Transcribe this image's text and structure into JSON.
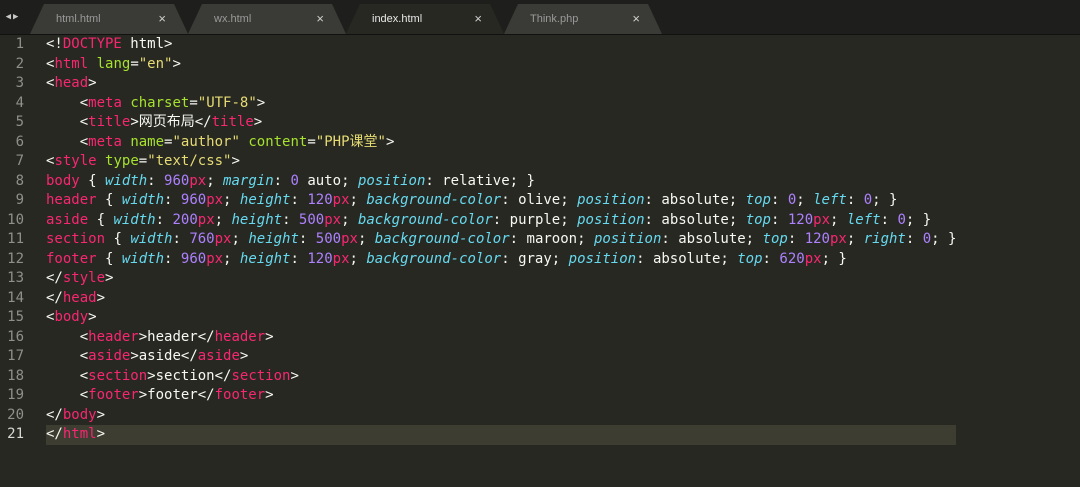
{
  "tabs": [
    {
      "label": "html.html",
      "active": false
    },
    {
      "label": "wx.html",
      "active": false
    },
    {
      "label": "index.html",
      "active": true
    },
    {
      "label": "Think.php",
      "active": false
    }
  ],
  "tab_close_glyph": "×",
  "nav": {
    "back_icon": "◀",
    "forward_icon": "▶"
  },
  "editor": {
    "current_line": 21,
    "line_numbers": [
      "1",
      "2",
      "3",
      "4",
      "5",
      "6",
      "7",
      "8",
      "9",
      "10",
      "11",
      "12",
      "13",
      "14",
      "15",
      "16",
      "17",
      "18",
      "19",
      "20",
      "21"
    ],
    "lines": [
      [
        [
          "p",
          "<!"
        ],
        [
          "tg",
          "DOCTYPE"
        ],
        [
          "p",
          " html>"
        ]
      ],
      [
        [
          "p",
          "<"
        ],
        [
          "tg",
          "html"
        ],
        [
          "p",
          " "
        ],
        [
          "at",
          "lang"
        ],
        [
          "p",
          "="
        ],
        [
          "st",
          "\"en\""
        ],
        [
          "p",
          ">"
        ]
      ],
      [
        [
          "p",
          "<"
        ],
        [
          "tg",
          "head"
        ],
        [
          "p",
          ">"
        ]
      ],
      [
        [
          "p",
          "    <"
        ],
        [
          "tg",
          "meta"
        ],
        [
          "p",
          " "
        ],
        [
          "at",
          "charset"
        ],
        [
          "p",
          "="
        ],
        [
          "st",
          "\"UTF-8\""
        ],
        [
          "p",
          ">"
        ]
      ],
      [
        [
          "p",
          "    <"
        ],
        [
          "tg",
          "title"
        ],
        [
          "p",
          ">网页布局</"
        ],
        [
          "tg",
          "title"
        ],
        [
          "p",
          ">"
        ]
      ],
      [
        [
          "p",
          "    <"
        ],
        [
          "tg",
          "meta"
        ],
        [
          "p",
          " "
        ],
        [
          "at",
          "name"
        ],
        [
          "p",
          "="
        ],
        [
          "st",
          "\"author\""
        ],
        [
          "p",
          " "
        ],
        [
          "at",
          "content"
        ],
        [
          "p",
          "="
        ],
        [
          "st",
          "\"PHP课堂\""
        ],
        [
          "p",
          ">"
        ]
      ],
      [
        [
          "p",
          "<"
        ],
        [
          "tg",
          "style"
        ],
        [
          "p",
          " "
        ],
        [
          "at",
          "type"
        ],
        [
          "p",
          "="
        ],
        [
          "st",
          "\"text/css\""
        ],
        [
          "p",
          ">"
        ]
      ],
      [
        [
          "tg",
          "body"
        ],
        [
          "p",
          " { "
        ],
        [
          "pr",
          "width"
        ],
        [
          "p",
          ": "
        ],
        [
          "nm",
          "960"
        ],
        [
          "un",
          "px"
        ],
        [
          "p",
          "; "
        ],
        [
          "pr",
          "margin"
        ],
        [
          "p",
          ": "
        ],
        [
          "nm",
          "0"
        ],
        [
          "p",
          " auto; "
        ],
        [
          "pr",
          "position"
        ],
        [
          "p",
          ": relative; }"
        ]
      ],
      [
        [
          "tg",
          "header"
        ],
        [
          "p",
          " { "
        ],
        [
          "pr",
          "width"
        ],
        [
          "p",
          ": "
        ],
        [
          "nm",
          "960"
        ],
        [
          "un",
          "px"
        ],
        [
          "p",
          "; "
        ],
        [
          "pr",
          "height"
        ],
        [
          "p",
          ": "
        ],
        [
          "nm",
          "120"
        ],
        [
          "un",
          "px"
        ],
        [
          "p",
          "; "
        ],
        [
          "pr",
          "background-color"
        ],
        [
          "p",
          ": olive; "
        ],
        [
          "pr",
          "position"
        ],
        [
          "p",
          ": absolute; "
        ],
        [
          "pr",
          "top"
        ],
        [
          "p",
          ": "
        ],
        [
          "nm",
          "0"
        ],
        [
          "p",
          "; "
        ],
        [
          "pr",
          "left"
        ],
        [
          "p",
          ": "
        ],
        [
          "nm",
          "0"
        ],
        [
          "p",
          "; }"
        ]
      ],
      [
        [
          "tg",
          "aside"
        ],
        [
          "p",
          " { "
        ],
        [
          "pr",
          "width"
        ],
        [
          "p",
          ": "
        ],
        [
          "nm",
          "200"
        ],
        [
          "un",
          "px"
        ],
        [
          "p",
          "; "
        ],
        [
          "pr",
          "height"
        ],
        [
          "p",
          ": "
        ],
        [
          "nm",
          "500"
        ],
        [
          "un",
          "px"
        ],
        [
          "p",
          "; "
        ],
        [
          "pr",
          "background-color"
        ],
        [
          "p",
          ": purple; "
        ],
        [
          "pr",
          "position"
        ],
        [
          "p",
          ": absolute; "
        ],
        [
          "pr",
          "top"
        ],
        [
          "p",
          ": "
        ],
        [
          "nm",
          "120"
        ],
        [
          "un",
          "px"
        ],
        [
          "p",
          "; "
        ],
        [
          "pr",
          "left"
        ],
        [
          "p",
          ": "
        ],
        [
          "nm",
          "0"
        ],
        [
          "p",
          "; }"
        ]
      ],
      [
        [
          "tg",
          "section"
        ],
        [
          "p",
          " { "
        ],
        [
          "pr",
          "width"
        ],
        [
          "p",
          ": "
        ],
        [
          "nm",
          "760"
        ],
        [
          "un",
          "px"
        ],
        [
          "p",
          "; "
        ],
        [
          "pr",
          "height"
        ],
        [
          "p",
          ": "
        ],
        [
          "nm",
          "500"
        ],
        [
          "un",
          "px"
        ],
        [
          "p",
          "; "
        ],
        [
          "pr",
          "background-color"
        ],
        [
          "p",
          ": maroon; "
        ],
        [
          "pr",
          "position"
        ],
        [
          "p",
          ": absolute; "
        ],
        [
          "pr",
          "top"
        ],
        [
          "p",
          ": "
        ],
        [
          "nm",
          "120"
        ],
        [
          "un",
          "px"
        ],
        [
          "p",
          "; "
        ],
        [
          "pr",
          "right"
        ],
        [
          "p",
          ": "
        ],
        [
          "nm",
          "0"
        ],
        [
          "p",
          "; }"
        ]
      ],
      [
        [
          "tg",
          "footer"
        ],
        [
          "p",
          " { "
        ],
        [
          "pr",
          "width"
        ],
        [
          "p",
          ": "
        ],
        [
          "nm",
          "960"
        ],
        [
          "un",
          "px"
        ],
        [
          "p",
          "; "
        ],
        [
          "pr",
          "height"
        ],
        [
          "p",
          ": "
        ],
        [
          "nm",
          "120"
        ],
        [
          "un",
          "px"
        ],
        [
          "p",
          "; "
        ],
        [
          "pr",
          "background-color"
        ],
        [
          "p",
          ": gray; "
        ],
        [
          "pr",
          "position"
        ],
        [
          "p",
          ": absolute; "
        ],
        [
          "pr",
          "top"
        ],
        [
          "p",
          ": "
        ],
        [
          "nm",
          "620"
        ],
        [
          "un",
          "px"
        ],
        [
          "p",
          "; }"
        ]
      ],
      [
        [
          "p",
          "</"
        ],
        [
          "tg",
          "style"
        ],
        [
          "p",
          ">"
        ]
      ],
      [
        [
          "p",
          "</"
        ],
        [
          "tg",
          "head"
        ],
        [
          "p",
          ">"
        ]
      ],
      [
        [
          "p",
          "<"
        ],
        [
          "tg",
          "body"
        ],
        [
          "p",
          ">"
        ]
      ],
      [
        [
          "p",
          "    <"
        ],
        [
          "tg",
          "header"
        ],
        [
          "p",
          ">header</"
        ],
        [
          "tg",
          "header"
        ],
        [
          "p",
          ">"
        ]
      ],
      [
        [
          "p",
          "    <"
        ],
        [
          "tg",
          "aside"
        ],
        [
          "p",
          ">aside</"
        ],
        [
          "tg",
          "aside"
        ],
        [
          "p",
          ">"
        ]
      ],
      [
        [
          "p",
          "    <"
        ],
        [
          "tg",
          "section"
        ],
        [
          "p",
          ">section</"
        ],
        [
          "tg",
          "section"
        ],
        [
          "p",
          ">"
        ]
      ],
      [
        [
          "p",
          "    <"
        ],
        [
          "tg",
          "footer"
        ],
        [
          "p",
          ">footer</"
        ],
        [
          "tg",
          "footer"
        ],
        [
          "p",
          ">"
        ]
      ],
      [
        [
          "p",
          "</"
        ],
        [
          "tg",
          "body"
        ],
        [
          "p",
          ">"
        ]
      ],
      [
        [
          "p",
          "</"
        ],
        [
          "tg",
          "html"
        ],
        [
          "p",
          ">"
        ]
      ]
    ]
  },
  "colors": {
    "background": "#272822",
    "tag": "#f92672",
    "attribute": "#a6e22e",
    "string": "#e6db74",
    "property": "#66d9ef",
    "number": "#ae81ff"
  }
}
